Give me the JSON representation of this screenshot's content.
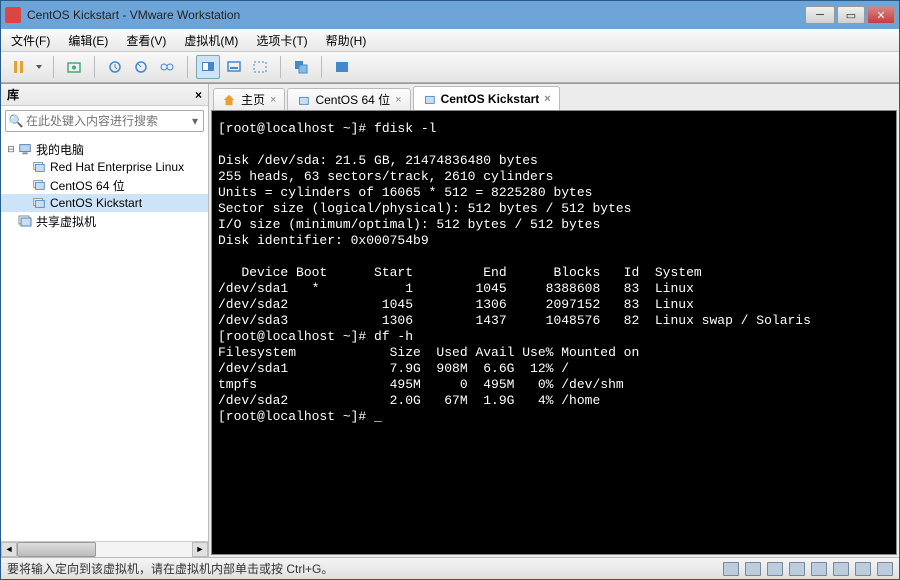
{
  "window": {
    "title": "CentOS Kickstart - VMware Workstation"
  },
  "menu": {
    "file": "文件(F)",
    "edit": "编辑(E)",
    "view": "查看(V)",
    "vm": "虚拟机(M)",
    "tabs": "选项卡(T)",
    "help": "帮助(H)"
  },
  "sidebar": {
    "header": "库",
    "search_placeholder": "在此处键入内容进行搜索",
    "nodes": {
      "root": "我的电脑",
      "n0": "Red Hat Enterprise Linux",
      "n1": "CentOS 64 位",
      "n2": "CentOS Kickstart",
      "shared": "共享虚拟机"
    }
  },
  "tabs": {
    "home": "主页",
    "t1": "CentOS 64 位",
    "t2": "CentOS Kickstart"
  },
  "terminal": {
    "line1": "[root@localhost ~]# fdisk -l",
    "line2": "",
    "line3": "Disk /dev/sda: 21.5 GB, 21474836480 bytes",
    "line4": "255 heads, 63 sectors/track, 2610 cylinders",
    "line5": "Units = cylinders of 16065 * 512 = 8225280 bytes",
    "line6": "Sector size (logical/physical): 512 bytes / 512 bytes",
    "line7": "I/O size (minimum/optimal): 512 bytes / 512 bytes",
    "line8": "Disk identifier: 0x000754b9",
    "line9": "",
    "line10": "   Device Boot      Start         End      Blocks   Id  System",
    "line11": "/dev/sda1   *           1        1045     8388608   83  Linux",
    "line12": "/dev/sda2            1045        1306     2097152   83  Linux",
    "line13": "/dev/sda3            1306        1437     1048576   82  Linux swap / Solaris",
    "line14": "[root@localhost ~]# df -h",
    "line15": "Filesystem            Size  Used Avail Use% Mounted on",
    "line16": "/dev/sda1             7.9G  908M  6.6G  12% /",
    "line17": "tmpfs                 495M     0  495M   0% /dev/shm",
    "line18": "/dev/sda2             2.0G   67M  1.9G   4% /home",
    "line19": "[root@localhost ~]# _"
  },
  "statusbar": {
    "text": "要将输入定向到该虚拟机，请在虚拟机内部单击或按 Ctrl+G。"
  }
}
